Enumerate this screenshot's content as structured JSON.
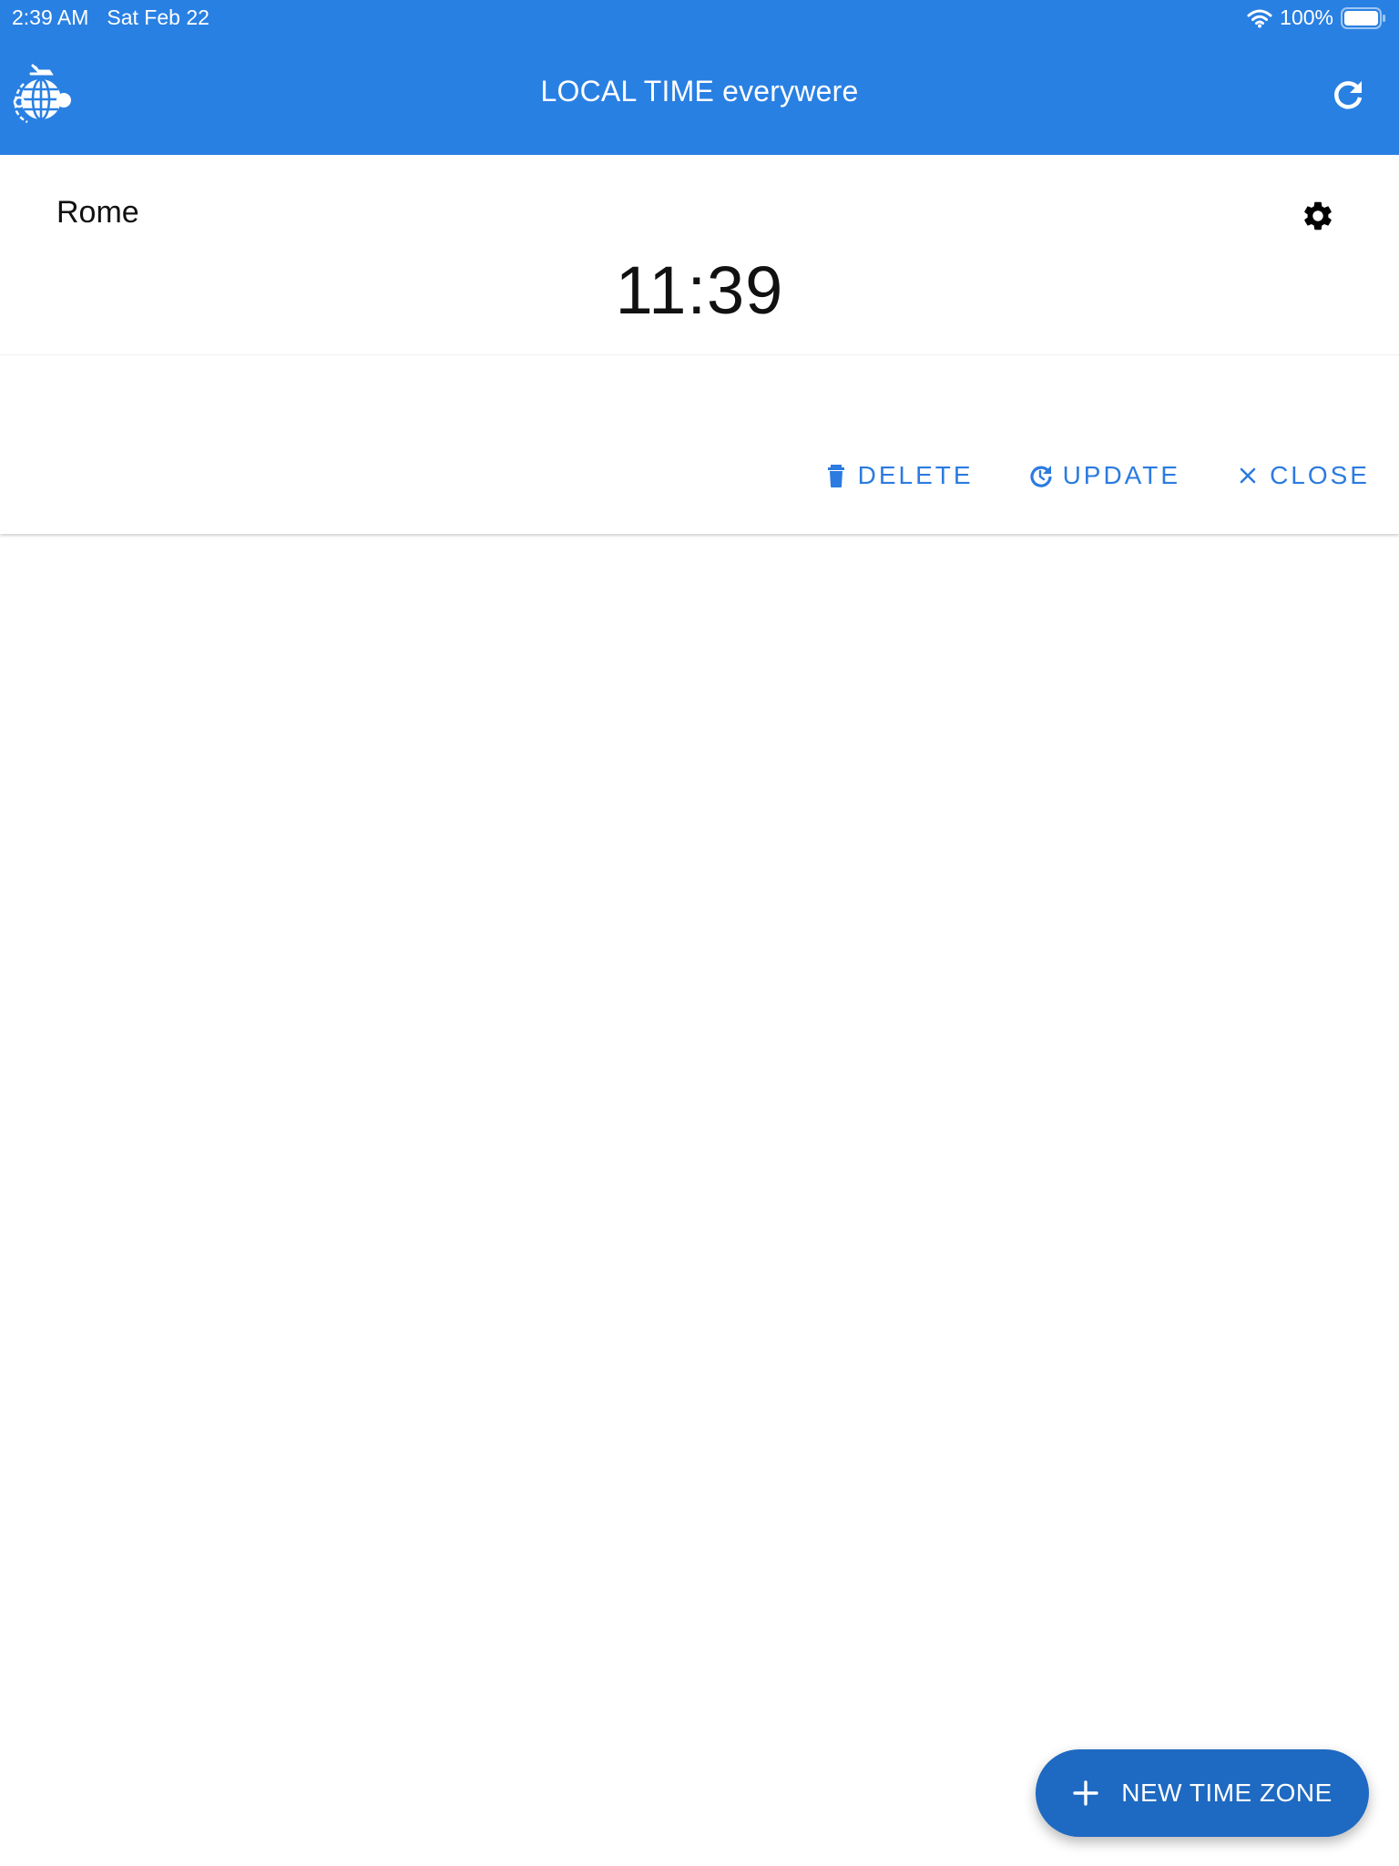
{
  "status_bar": {
    "time": "2:39 AM",
    "date": "Sat Feb 22",
    "battery_percent": "100%",
    "icons": [
      "wifi-icon",
      "battery-icon"
    ]
  },
  "app_bar": {
    "title": "LOCAL TIME everywere",
    "logo_icon": "globe-plane-icon",
    "refresh_icon": "refresh-icon",
    "background_color": "#2980e3"
  },
  "time_zone_card": {
    "city": "Rome",
    "time": "11:39",
    "settings_icon": "gear-icon",
    "actions": [
      {
        "label": "DELETE",
        "icon": "trash-icon"
      },
      {
        "label": "UPDATE",
        "icon": "update-clock-icon"
      },
      {
        "label": "CLOSE",
        "icon": "close-icon"
      }
    ],
    "action_color": "#2c7be0"
  },
  "fab": {
    "label": "NEW TIME ZONE",
    "icon": "plus-icon",
    "color": "#1e69c2"
  }
}
